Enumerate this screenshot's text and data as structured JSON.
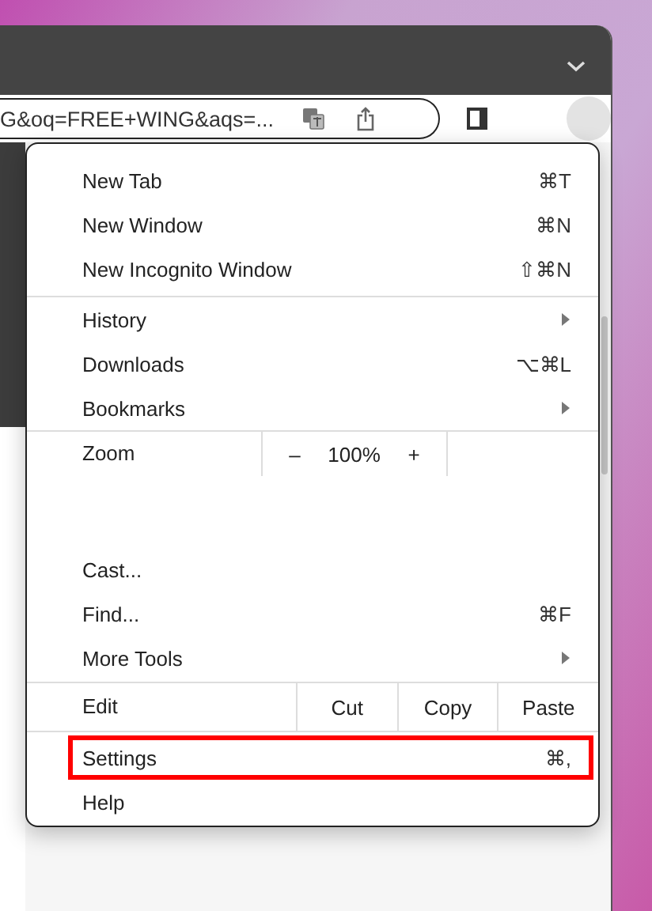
{
  "address_bar": {
    "url": "G&oq=FREE+WING&aqs=..."
  },
  "menu": {
    "sections": [
      {
        "items": [
          {
            "kind": "command",
            "label": "New Tab",
            "shortcut": "⌘T",
            "submenu": false,
            "highlighted": false
          },
          {
            "kind": "command",
            "label": "New Window",
            "shortcut": "⌘N",
            "submenu": false,
            "highlighted": false
          },
          {
            "kind": "command",
            "label": "New Incognito Window",
            "shortcut": "⇧⌘N",
            "submenu": false,
            "highlighted": false
          }
        ]
      },
      {
        "items": [
          {
            "kind": "command",
            "label": "History",
            "submenu": true,
            "highlighted": false
          },
          {
            "kind": "command",
            "label": "Downloads",
            "shortcut": "⌥⌘L",
            "submenu": false,
            "highlighted": false
          },
          {
            "kind": "command",
            "label": "Bookmarks",
            "submenu": true,
            "highlighted": false
          }
        ]
      },
      {
        "items": [
          {
            "kind": "zoom",
            "label": "Zoom",
            "minus": "–",
            "value": "100%",
            "plus": "+"
          },
          {
            "kind": "command",
            "label": "Cast...",
            "submenu": false,
            "highlighted": false
          },
          {
            "kind": "command",
            "label": "Find...",
            "shortcut": "⌘F",
            "submenu": false,
            "highlighted": false
          },
          {
            "kind": "command",
            "label": "More Tools",
            "submenu": true,
            "highlighted": false
          }
        ]
      },
      {
        "items": [
          {
            "kind": "edit",
            "label": "Edit",
            "buttons": [
              "Cut",
              "Copy",
              "Paste"
            ]
          }
        ]
      },
      {
        "items": [
          {
            "kind": "command",
            "label": "Settings",
            "shortcut": "⌘,",
            "submenu": false,
            "highlighted": true
          },
          {
            "kind": "command",
            "label": "Help",
            "submenu": false,
            "highlighted": false
          }
        ]
      }
    ]
  }
}
